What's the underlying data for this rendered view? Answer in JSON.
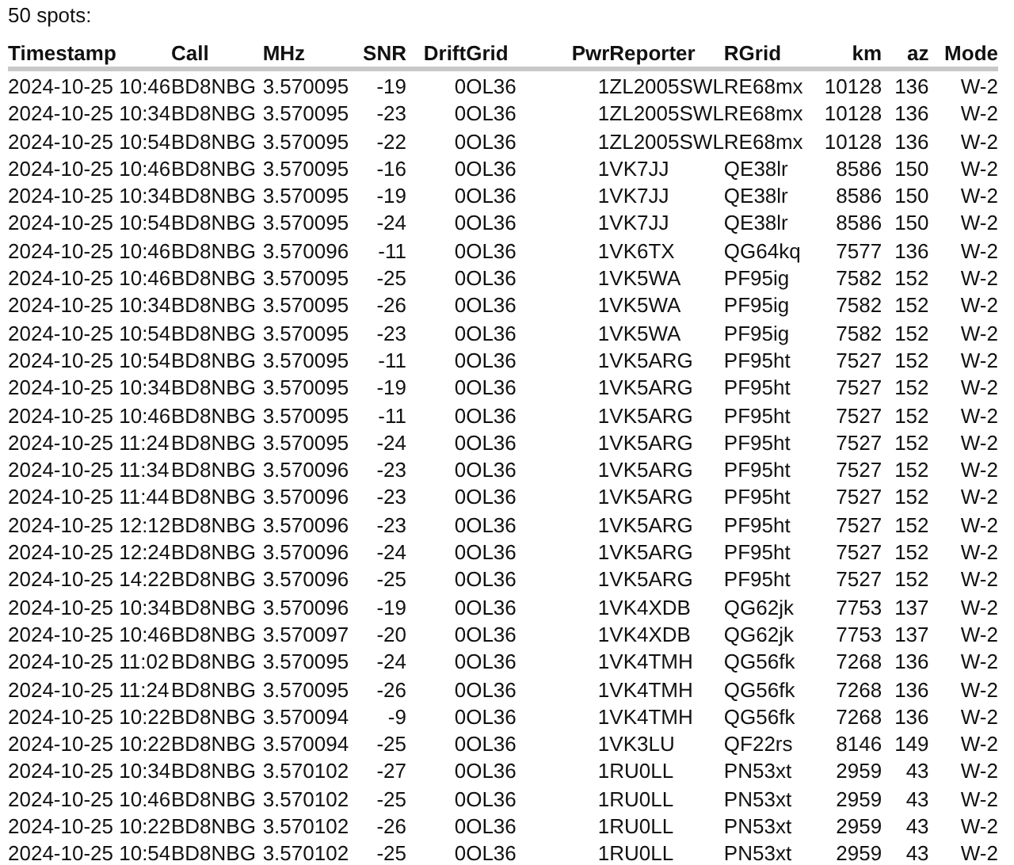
{
  "summary": "50 spots:",
  "table": {
    "columns": [
      "Timestamp",
      "Call",
      "MHz",
      "SNR",
      "Drift",
      "Grid",
      "Pwr",
      "Reporter",
      "RGrid",
      "km",
      "az",
      "Mode"
    ],
    "rows": [
      [
        "2024-10-25 10:46",
        "BD8NBG",
        "3.570095",
        "-19",
        "0",
        "OL36",
        "1",
        "ZL2005SWL",
        "RE68mx",
        "10128",
        "136",
        "W-2"
      ],
      [
        "2024-10-25 10:34",
        "BD8NBG",
        "3.570095",
        "-23",
        "0",
        "OL36",
        "1",
        "ZL2005SWL",
        "RE68mx",
        "10128",
        "136",
        "W-2"
      ],
      [
        "2024-10-25 10:54",
        "BD8NBG",
        "3.570095",
        "-22",
        "0",
        "OL36",
        "1",
        "ZL2005SWL",
        "RE68mx",
        "10128",
        "136",
        "W-2"
      ],
      [
        "2024-10-25 10:46",
        "BD8NBG",
        "3.570095",
        "-16",
        "0",
        "OL36",
        "1",
        "VK7JJ",
        "QE38lr",
        "8586",
        "150",
        "W-2"
      ],
      [
        "2024-10-25 10:34",
        "BD8NBG",
        "3.570095",
        "-19",
        "0",
        "OL36",
        "1",
        "VK7JJ",
        "QE38lr",
        "8586",
        "150",
        "W-2"
      ],
      [
        "2024-10-25 10:54",
        "BD8NBG",
        "3.570095",
        "-24",
        "0",
        "OL36",
        "1",
        "VK7JJ",
        "QE38lr",
        "8586",
        "150",
        "W-2"
      ],
      [
        "2024-10-25 10:46",
        "BD8NBG",
        "3.570096",
        "-11",
        "0",
        "OL36",
        "1",
        "VK6TX",
        "QG64kq",
        "7577",
        "136",
        "W-2"
      ],
      [
        "2024-10-25 10:46",
        "BD8NBG",
        "3.570095",
        "-25",
        "0",
        "OL36",
        "1",
        "VK5WA",
        "PF95ig",
        "7582",
        "152",
        "W-2"
      ],
      [
        "2024-10-25 10:34",
        "BD8NBG",
        "3.570095",
        "-26",
        "0",
        "OL36",
        "1",
        "VK5WA",
        "PF95ig",
        "7582",
        "152",
        "W-2"
      ],
      [
        "2024-10-25 10:54",
        "BD8NBG",
        "3.570095",
        "-23",
        "0",
        "OL36",
        "1",
        "VK5WA",
        "PF95ig",
        "7582",
        "152",
        "W-2"
      ],
      [
        "2024-10-25 10:54",
        "BD8NBG",
        "3.570095",
        "-11",
        "0",
        "OL36",
        "1",
        "VK5ARG",
        "PF95ht",
        "7527",
        "152",
        "W-2"
      ],
      [
        "2024-10-25 10:34",
        "BD8NBG",
        "3.570095",
        "-19",
        "0",
        "OL36",
        "1",
        "VK5ARG",
        "PF95ht",
        "7527",
        "152",
        "W-2"
      ],
      [
        "2024-10-25 10:46",
        "BD8NBG",
        "3.570095",
        "-11",
        "0",
        "OL36",
        "1",
        "VK5ARG",
        "PF95ht",
        "7527",
        "152",
        "W-2"
      ],
      [
        "2024-10-25 11:24",
        "BD8NBG",
        "3.570095",
        "-24",
        "0",
        "OL36",
        "1",
        "VK5ARG",
        "PF95ht",
        "7527",
        "152",
        "W-2"
      ],
      [
        "2024-10-25 11:34",
        "BD8NBG",
        "3.570096",
        "-23",
        "0",
        "OL36",
        "1",
        "VK5ARG",
        "PF95ht",
        "7527",
        "152",
        "W-2"
      ],
      [
        "2024-10-25 11:44",
        "BD8NBG",
        "3.570096",
        "-23",
        "0",
        "OL36",
        "1",
        "VK5ARG",
        "PF95ht",
        "7527",
        "152",
        "W-2"
      ],
      [
        "2024-10-25 12:12",
        "BD8NBG",
        "3.570096",
        "-23",
        "0",
        "OL36",
        "1",
        "VK5ARG",
        "PF95ht",
        "7527",
        "152",
        "W-2"
      ],
      [
        "2024-10-25 12:24",
        "BD8NBG",
        "3.570096",
        "-24",
        "0",
        "OL36",
        "1",
        "VK5ARG",
        "PF95ht",
        "7527",
        "152",
        "W-2"
      ],
      [
        "2024-10-25 14:22",
        "BD8NBG",
        "3.570096",
        "-25",
        "0",
        "OL36",
        "1",
        "VK5ARG",
        "PF95ht",
        "7527",
        "152",
        "W-2"
      ],
      [
        "2024-10-25 10:34",
        "BD8NBG",
        "3.570096",
        "-19",
        "0",
        "OL36",
        "1",
        "VK4XDB",
        "QG62jk",
        "7753",
        "137",
        "W-2"
      ],
      [
        "2024-10-25 10:46",
        "BD8NBG",
        "3.570097",
        "-20",
        "0",
        "OL36",
        "1",
        "VK4XDB",
        "QG62jk",
        "7753",
        "137",
        "W-2"
      ],
      [
        "2024-10-25 11:02",
        "BD8NBG",
        "3.570095",
        "-24",
        "0",
        "OL36",
        "1",
        "VK4TMH",
        "QG56fk",
        "7268",
        "136",
        "W-2"
      ],
      [
        "2024-10-25 11:24",
        "BD8NBG",
        "3.570095",
        "-26",
        "0",
        "OL36",
        "1",
        "VK4TMH",
        "QG56fk",
        "7268",
        "136",
        "W-2"
      ],
      [
        "2024-10-25 10:22",
        "BD8NBG",
        "3.570094",
        "-9",
        "0",
        "OL36",
        "1",
        "VK4TMH",
        "QG56fk",
        "7268",
        "136",
        "W-2"
      ],
      [
        "2024-10-25 10:22",
        "BD8NBG",
        "3.570094",
        "-25",
        "0",
        "OL36",
        "1",
        "VK3LU",
        "QF22rs",
        "8146",
        "149",
        "W-2"
      ],
      [
        "2024-10-25 10:34",
        "BD8NBG",
        "3.570102",
        "-27",
        "0",
        "OL36",
        "1",
        "RU0LL",
        "PN53xt",
        "2959",
        "43",
        "W-2"
      ],
      [
        "2024-10-25 10:46",
        "BD8NBG",
        "3.570102",
        "-25",
        "0",
        "OL36",
        "1",
        "RU0LL",
        "PN53xt",
        "2959",
        "43",
        "W-2"
      ],
      [
        "2024-10-25 10:22",
        "BD8NBG",
        "3.570102",
        "-26",
        "0",
        "OL36",
        "1",
        "RU0LL",
        "PN53xt",
        "2959",
        "43",
        "W-2"
      ],
      [
        "2024-10-25 10:54",
        "BD8NBG",
        "3.570102",
        "-25",
        "0",
        "OL36",
        "1",
        "RU0LL",
        "PN53xt",
        "2959",
        "43",
        "W-2"
      ]
    ]
  }
}
